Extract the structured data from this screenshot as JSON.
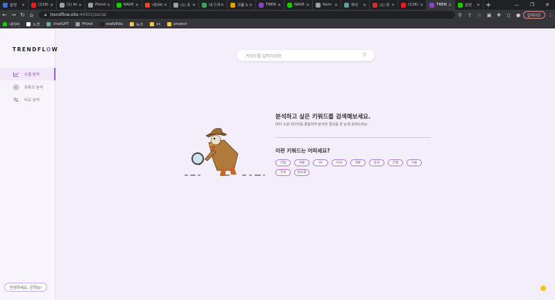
{
  "browser": {
    "tabs": [
      {
        "label": "삼성",
        "color": "#3d6fd8"
      },
      {
        "label": "(118)",
        "color": "#e62117"
      },
      {
        "label": "(1) AI",
        "color": "#9aa0a6"
      },
      {
        "label": "Phind",
        "color": "#9aa0a6"
      },
      {
        "label": "NAVE",
        "color": "#1ec800"
      },
      {
        "label": "네이버",
        "color": "#e8452c"
      },
      {
        "label": "(1) 프",
        "color": "#9aa0a6"
      },
      {
        "label": "내 드라",
        "color": "#34a853"
      },
      {
        "label": "크롬 S",
        "color": "#f29900"
      },
      {
        "label": "TREN",
        "color": "#8e44c8"
      },
      {
        "label": "NAVE",
        "color": "#1ec800"
      },
      {
        "label": "Nam",
        "color": "#9aa0a6"
      },
      {
        "label": "파이",
        "color": "#5f9ea0"
      },
      {
        "label": "(1) 장",
        "color": "#d93025"
      },
      {
        "label": "(118)",
        "color": "#e62117"
      },
      {
        "label": "TREN",
        "color": "#8e44c8"
      },
      {
        "label": "삼성",
        "color": "#1ec800"
      }
    ],
    "active_tab_index": 15,
    "new_tab_label": "+",
    "address": {
      "host": "trendflow.site",
      "path": ":44301/social"
    },
    "update_label": "업데이트",
    "bookmarks": [
      {
        "label": "네이버",
        "color": "#1ec800"
      },
      {
        "label": "노션",
        "color": "#ffffff"
      },
      {
        "label": "chatGPT",
        "color": "#74aa9c"
      },
      {
        "label": "Phind",
        "color": "#9aa0a6"
      },
      {
        "label": "ssafyEdu",
        "color": "#222222"
      },
      {
        "label": "뉴스",
        "color": "#f2c744"
      },
      {
        "label": "cs",
        "color": "#f2c744"
      },
      {
        "label": "project",
        "color": "#f2c744"
      }
    ]
  },
  "app": {
    "logo_prefix": "TRENDFL",
    "logo_o": "O",
    "logo_suffix": "W",
    "nav": [
      {
        "label": "소셜 분석",
        "icon": "line-chart-icon",
        "active": true
      },
      {
        "label": "유튜브 분석",
        "icon": "youtube-circle-icon",
        "active": false
      },
      {
        "label": "비교 분석",
        "icon": "sliders-icon",
        "active": false
      }
    ],
    "greeting": "안녕하세요, 은혁님!",
    "search": {
      "placeholder": "키워드를 입력하세요"
    },
    "headline": "분석하고 싶은 키워드를 검색해보세요.",
    "subline": "여러 소셜 미디어를 종합하여 분석한 결과를 한 눈에 보여드려요.",
    "keyword_title": "이런 키워드는 어떠세요?",
    "keywords": [
      "기업",
      "서울",
      "AI",
      "미국",
      "대표",
      "중국",
      "은행",
      "기술",
      "가격",
      "반도체"
    ],
    "accent_color": "#9b59d0"
  }
}
